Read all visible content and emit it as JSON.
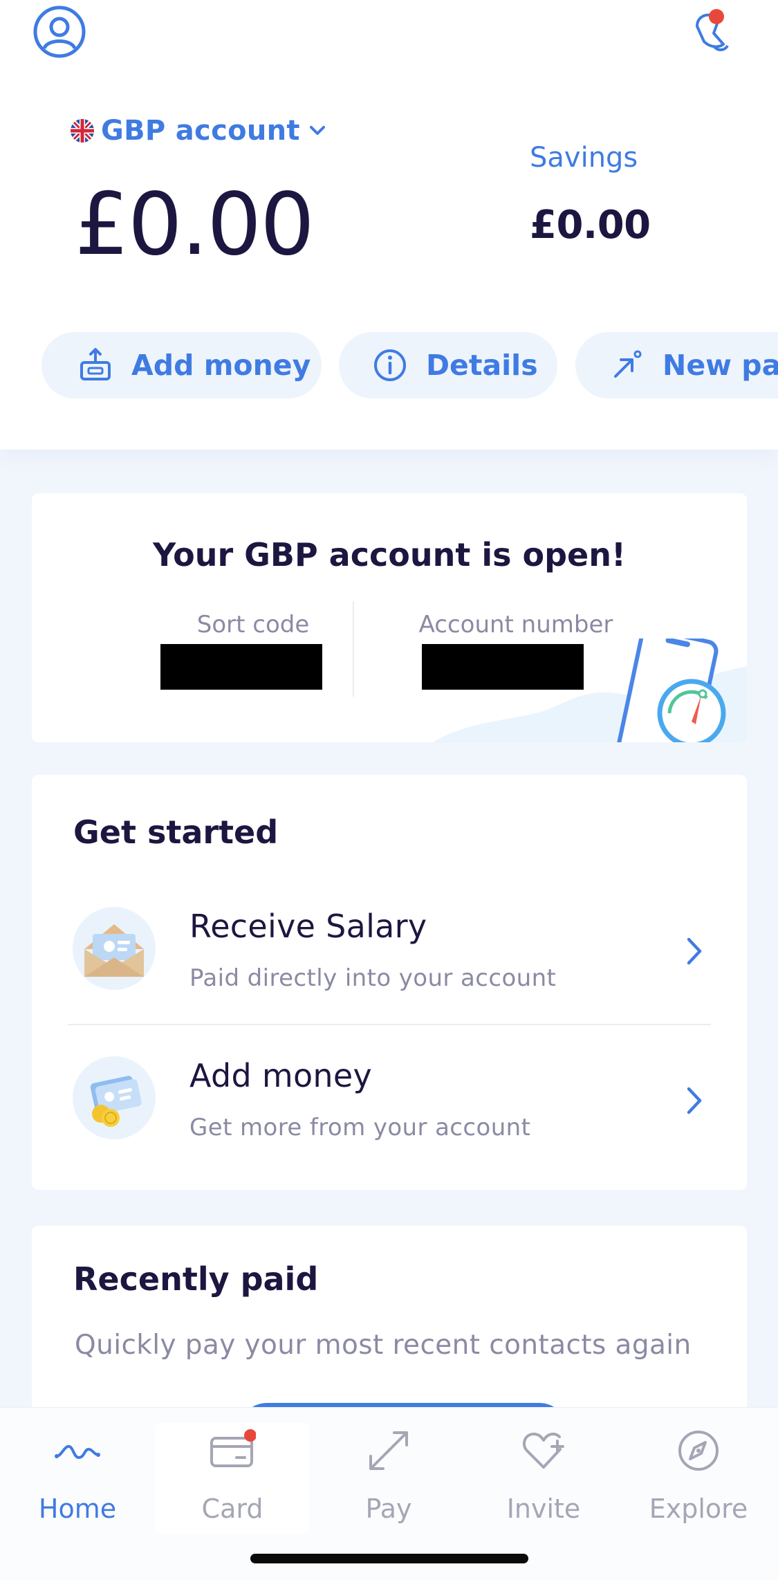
{
  "header": {
    "profile_icon": "profile-icon",
    "notification_icon": "bell-icon",
    "account_selector": {
      "label": "GBP account",
      "flag": "uk-flag"
    },
    "balance": "£0.00",
    "savings": {
      "label": "Savings",
      "amount": "£0.00"
    }
  },
  "actions": [
    {
      "label": "Add money",
      "icon": "add-money-icon"
    },
    {
      "label": "Details",
      "icon": "info-icon"
    },
    {
      "label": "New pay",
      "icon": "new-payment-icon"
    }
  ],
  "account_open_card": {
    "title": "Your GBP account is open!",
    "sort_code_label": "Sort code",
    "account_number_label": "Account number"
  },
  "get_started": {
    "title": "Get started",
    "items": [
      {
        "title": "Receive Salary",
        "subtitle": "Paid directly into your account",
        "icon": "salary-envelope-icon"
      },
      {
        "title": "Add money",
        "subtitle": "Get more from your account",
        "icon": "cards-coins-icon"
      }
    ]
  },
  "recently_paid": {
    "title": "Recently paid",
    "subtitle": "Quickly pay your most recent contacts again"
  },
  "tabbar": {
    "tabs": [
      {
        "label": "Home",
        "icon": "home-wave-icon",
        "active": true
      },
      {
        "label": "Card",
        "icon": "card-icon",
        "active": false,
        "badge": true
      },
      {
        "label": "Pay",
        "icon": "pay-arrows-icon",
        "active": false
      },
      {
        "label": "Invite",
        "icon": "heart-plus-icon",
        "active": false
      },
      {
        "label": "Explore",
        "icon": "compass-icon",
        "active": false
      }
    ]
  },
  "colors": {
    "accent": "#3f7be2",
    "text_dark": "#1c1740",
    "text_muted": "#8a8aa3",
    "background": "#f1f6fd",
    "badge": "#e8483c"
  }
}
